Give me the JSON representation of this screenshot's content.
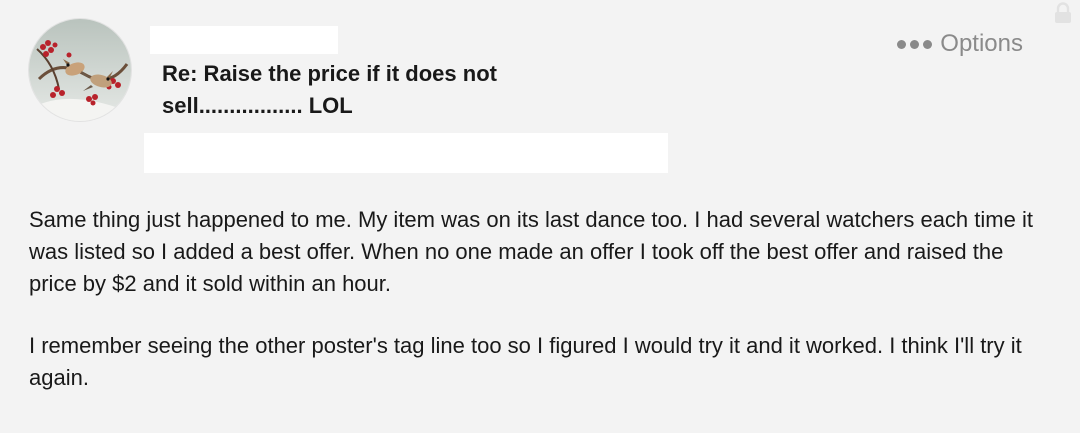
{
  "post": {
    "subject": "Re: Raise the price if it does not sell................. LOL",
    "options_label": "Options",
    "paragraphs": [
      "Same thing just happened to me.  My item was on its last dance too.  I had several watchers each time it was listed so I added a best offer.  When no one made an offer I took off the best offer and raised the price by $2 and it sold within an hour.",
      "I remember seeing the other poster's tag line too so I figured I would try it and it worked.  I think I'll try it again."
    ]
  },
  "icons": {
    "avatar": "avatar-birds-on-berries",
    "options": "more-dots-icon",
    "lock": "lock-icon"
  },
  "colors": {
    "background": "#f3f3f3",
    "text": "#191919",
    "muted": "#8a8a8a"
  }
}
